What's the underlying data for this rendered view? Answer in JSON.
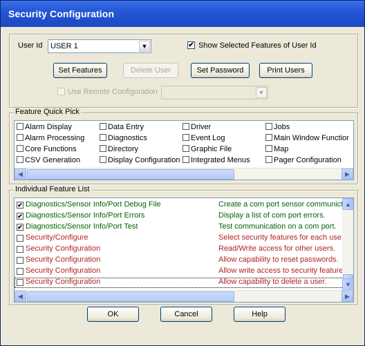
{
  "window": {
    "title": "Security Configuration"
  },
  "user": {
    "label": "User Id",
    "selected": "USER 1",
    "show_selected_label": "Show Selected Features of User Id",
    "show_selected_checked": true
  },
  "buttons": {
    "set_features": "Set Features",
    "delete_user": "Delete User",
    "set_password": "Set Password",
    "print_users": "Print Users"
  },
  "remote": {
    "label": "Use Remote Configuration",
    "value": ""
  },
  "quick_pick": {
    "label": "Feature Quick Pick",
    "columns": [
      [
        "Alarm Display",
        "Alarm Processing",
        "Core Functions",
        "CSV Generation"
      ],
      [
        "Data Entry",
        "Diagnostics",
        "Directory",
        "Display Configuration"
      ],
      [
        "Driver",
        "Event Log",
        "Graphic File",
        "Integrated Menus"
      ],
      [
        "Jobs",
        "Main Window Functior",
        "Map",
        "Pager Configuration"
      ]
    ]
  },
  "feature_list": {
    "label": "Individual Feature List",
    "rows": [
      {
        "name": "Diagnostics/Sensor Info/Port Debug File",
        "desc": "Create a com port sensor communict",
        "checked": "✔"
      },
      {
        "name": "Diagnostics/Sensor Info/Port Errors",
        "desc": "Display a list of com port errors.",
        "checked": "✔"
      },
      {
        "name": "Diagnostics/Sensor Info/Port Test",
        "desc": "Test communication on a com port.",
        "checked": "✔"
      },
      {
        "name": "Security/Configure",
        "desc": "Select security features for each use",
        "checked": ""
      },
      {
        "name": "Security Configuration",
        "desc": "Read/Write access for other users.",
        "checked": ""
      },
      {
        "name": "Security Configuration",
        "desc": "Allow capability to reset passwords.",
        "checked": ""
      },
      {
        "name": "Security Configuration",
        "desc": "Allow write access to security feature",
        "checked": ""
      },
      {
        "name": "Security Configuration",
        "desc": "Allow capability to delete a user.",
        "checked": ""
      }
    ]
  },
  "footer": {
    "ok": "OK",
    "cancel": "Cancel",
    "help": "Help"
  },
  "colors": {
    "title_bar": "#2457d6",
    "enabled_feature": "#006400",
    "disabled_feature": "#b22222"
  }
}
